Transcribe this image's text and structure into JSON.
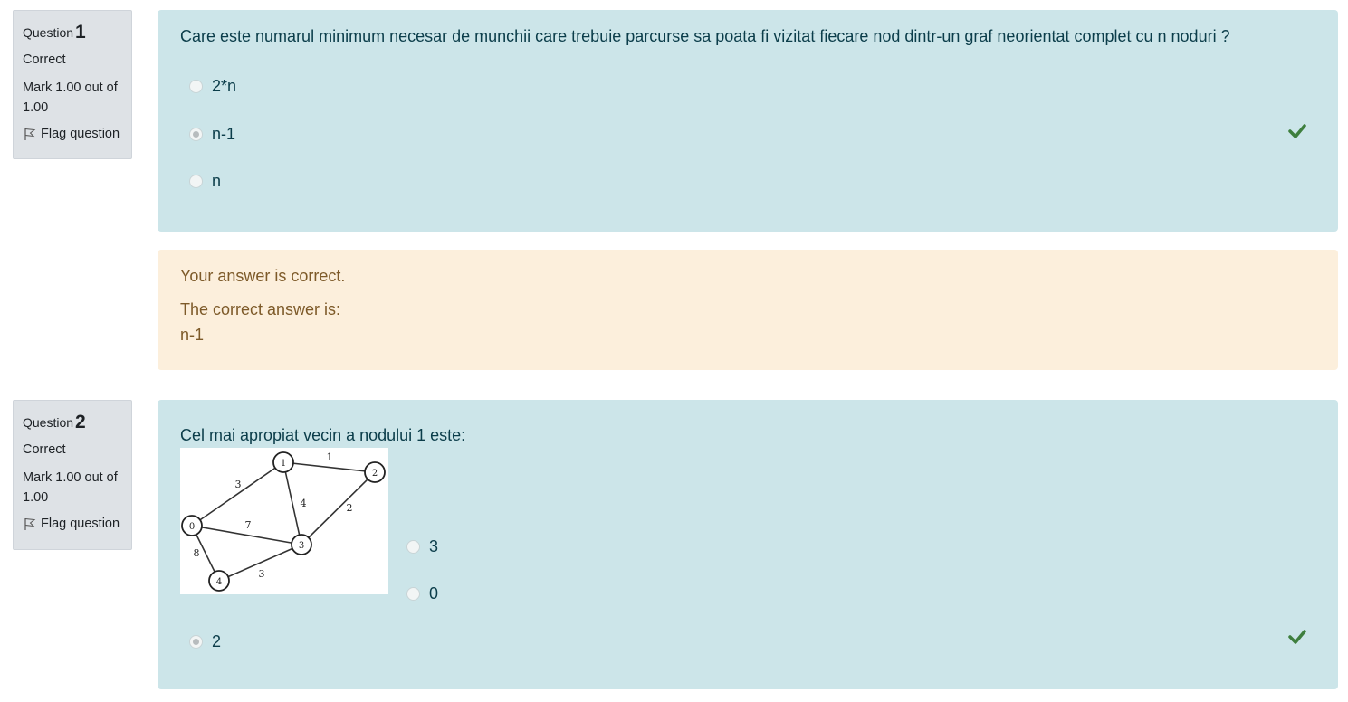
{
  "questions": [
    {
      "label": "Question",
      "number": "1",
      "state": "Correct",
      "grade": "Mark 1.00 out of 1.00",
      "flag_label": "Flag question",
      "text": "Care este numarul minimum necesar de munchii care trebuie parcurse sa poata fi vizitat fiecare nod dintr-un graf neorientat complet cu n noduri ?",
      "options": [
        {
          "label": "2*n",
          "selected": false
        },
        {
          "label": "n-1",
          "selected": true
        },
        {
          "label": "n",
          "selected": false
        }
      ],
      "feedback": {
        "result": "Your answer is correct.",
        "correct_answer_label": "The correct answer is:",
        "correct_answer": "n-1"
      }
    },
    {
      "label": "Question",
      "number": "2",
      "state": "Correct",
      "grade": "Mark 1.00 out of 1.00",
      "flag_label": "Flag question",
      "text": "Cel mai apropiat vecin a nodului 1 este:",
      "graph": {
        "nodes": [
          "0",
          "1",
          "2",
          "3",
          "4"
        ],
        "edge_weights": [
          "3",
          "1",
          "4",
          "2",
          "7",
          "8",
          "3"
        ]
      },
      "options": [
        {
          "label": "3",
          "selected": false
        },
        {
          "label": "0",
          "selected": false
        },
        {
          "label": "2",
          "selected": true
        }
      ]
    }
  ],
  "colors": {
    "formulation_bg": "#cce5e9",
    "feedback_bg": "#fcefdc",
    "info_bg": "#dee2e6",
    "correct_check": "#3e7f3e"
  },
  "icons": {
    "flag": "flag-icon",
    "correct": "check-icon"
  }
}
